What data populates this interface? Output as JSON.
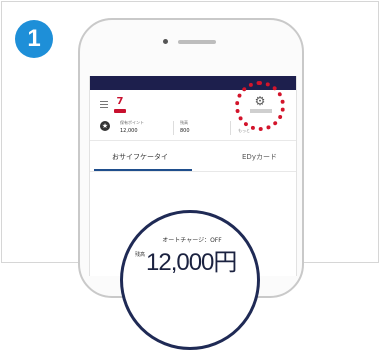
{
  "step": {
    "number": "1",
    "color": "#1e8fd8"
  },
  "app": {
    "header_color": "#1d1f4d",
    "brand_icon": "seven-logo",
    "settings_icon": "gear-icon",
    "highlight_color": "#d3142b",
    "points": {
      "label": "保有ポイント",
      "value": "12,000"
    },
    "bonus": {
      "label": "残高",
      "value": "800"
    },
    "more": "もっと",
    "tabs": [
      {
        "label": "おサイフケータイ",
        "selected": true
      },
      {
        "label": "EDyカード",
        "selected": false
      }
    ],
    "autocharge_label": "オートチャージ：OFF",
    "balance_prefix": "残高",
    "balance": "12,000円"
  }
}
